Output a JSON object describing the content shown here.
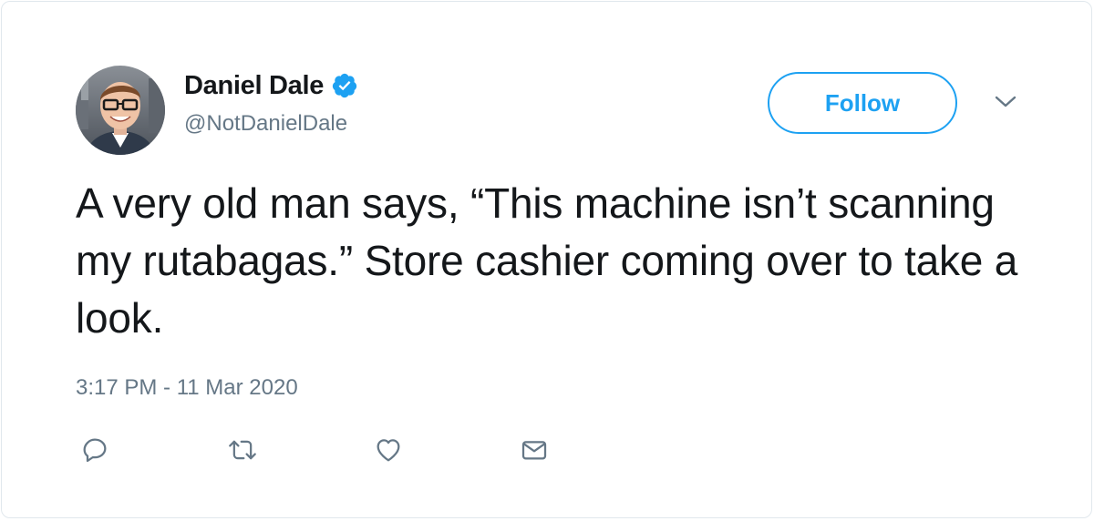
{
  "author": {
    "display_name": "Daniel Dale",
    "handle": "@NotDanielDale",
    "verified_icon": "verified-badge-icon"
  },
  "follow": {
    "label": "Follow"
  },
  "menu": {
    "icon": "chevron-down-icon"
  },
  "tweet": {
    "text": "A very old man says, “This machine isn’t scanning my rutabagas.” Store cashier coming over to take a look.",
    "timestamp": "3:17 PM - 11 Mar 2020"
  },
  "actions": [
    {
      "icon": "reply-icon"
    },
    {
      "icon": "retweet-icon"
    },
    {
      "icon": "like-icon"
    },
    {
      "icon": "direct-message-icon"
    }
  ],
  "colors": {
    "accent": "#1da1f2",
    "text": "#14171a",
    "secondary": "#657786",
    "border": "#e1e8ed"
  }
}
